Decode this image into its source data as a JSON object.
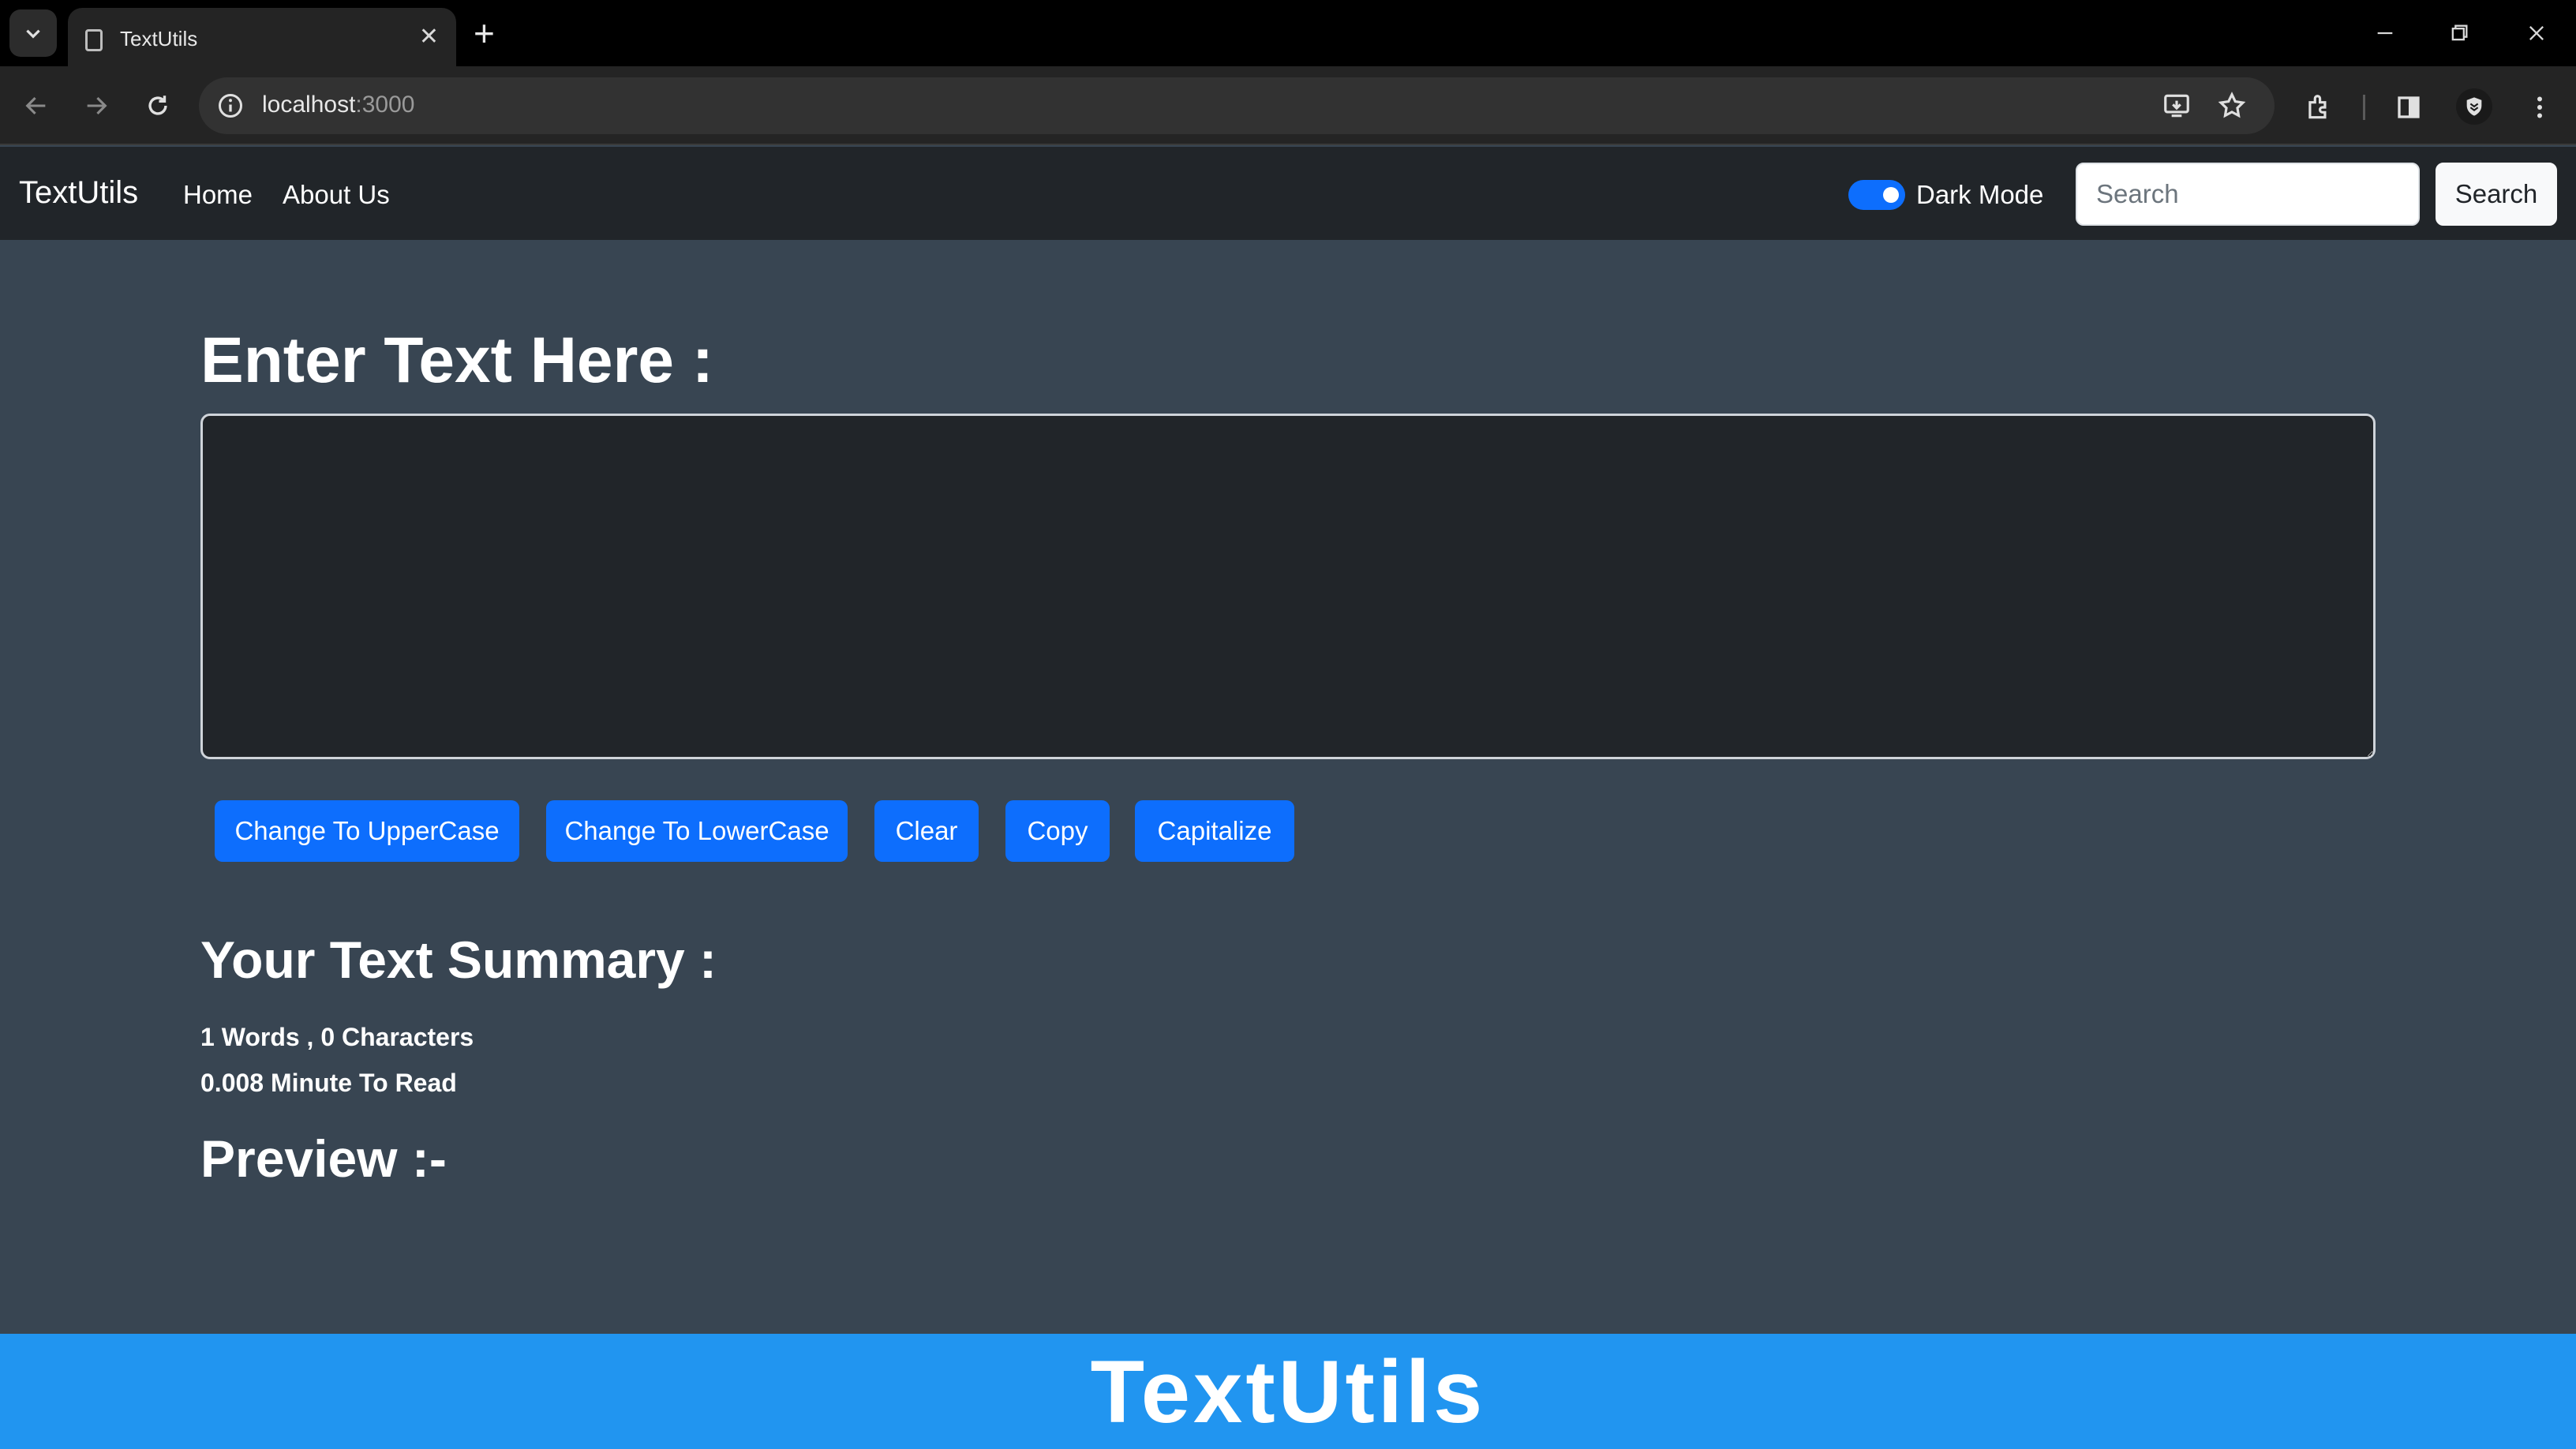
{
  "browser": {
    "tab_title": "TextUtils",
    "url_host": "localhost",
    "url_port": ":3000"
  },
  "navbar": {
    "brand": "TextUtils",
    "links": [
      "Home",
      "About Us"
    ],
    "dark_mode_label": "Dark Mode",
    "dark_mode_on": true,
    "search_placeholder": "Search",
    "search_button": "Search"
  },
  "main": {
    "heading": "Enter Text Here :",
    "textarea_value": "",
    "buttons": [
      "Change To UpperCase",
      "Change To LowerCase",
      "Clear",
      "Copy",
      "Capitalize"
    ],
    "summary_heading": "Your Text Summary :",
    "word_char_count": "1 Words , 0 Characters",
    "read_time": "0.008 Minute To Read",
    "preview_heading": "Preview :-"
  },
  "banner": {
    "text": "TextUtils"
  },
  "colors": {
    "page_bg": "#384552",
    "navbar_bg": "#212529",
    "primary": "#0d6efd",
    "banner_bg": "#2195f0"
  }
}
